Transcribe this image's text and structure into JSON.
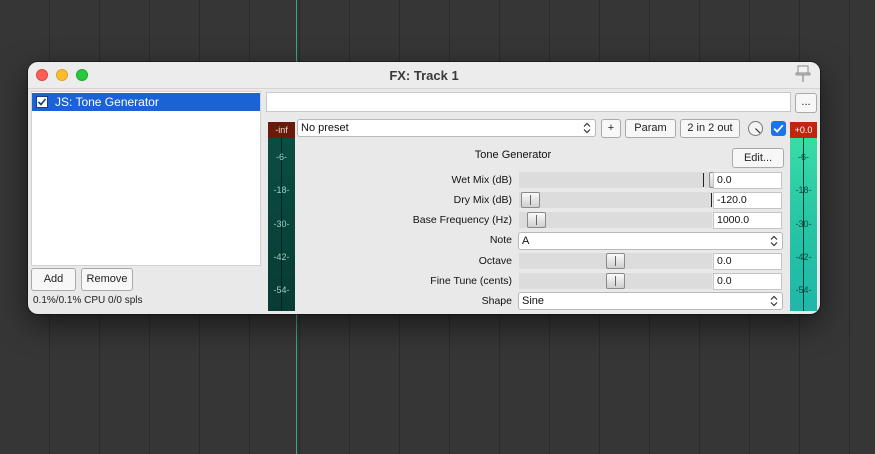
{
  "window": {
    "title": "FX: Track 1"
  },
  "fx_chain": {
    "items": [
      {
        "label": "JS: Tone Generator",
        "enabled": true
      }
    ],
    "add_label": "Add",
    "remove_label": "Remove",
    "cpu_status": "0.1%/0.1% CPU 0/0 spls"
  },
  "toolbar": {
    "more_label": "...",
    "preset": "No preset",
    "plus_label": "+",
    "param_label": "Param",
    "io_label": "2 in 2 out"
  },
  "meters": {
    "left_peak": "-inf",
    "right_peak": "+0.0",
    "ticks": [
      "-6-",
      "-18-",
      "-30-",
      "-42-",
      "-54-"
    ]
  },
  "plugin": {
    "title": "Tone Generator",
    "edit_label": "Edit...",
    "params": [
      {
        "label": "Wet Mix (dB)",
        "value": "0.0"
      },
      {
        "label": "Dry Mix (dB)",
        "value": "-120.0"
      },
      {
        "label": "Base Frequency (Hz)",
        "value": "1000.0"
      },
      {
        "label": "Note",
        "value": "A"
      },
      {
        "label": "Octave",
        "value": "0.0"
      },
      {
        "label": "Fine Tune (cents)",
        "value": "0.0"
      },
      {
        "label": "Shape",
        "value": "Sine"
      }
    ]
  },
  "colors": {
    "selection": "#1b62d6",
    "meter_active": "#27c4a5",
    "meter_clip": "#c0260e",
    "accent": "#1b74e8"
  }
}
